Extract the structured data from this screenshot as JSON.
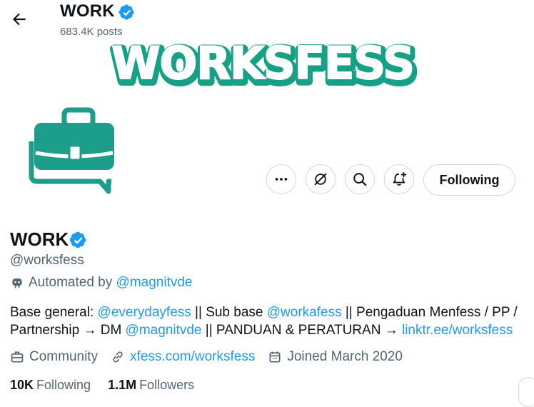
{
  "header": {
    "title": "WORK",
    "posts": "683.4K posts"
  },
  "banner": {
    "wordmark": "WORKSFESS",
    "fill_color": "#ffffff",
    "outline_color": "#16a085"
  },
  "avatar": {
    "icon": "briefcase-chat-icon",
    "color": "#1c9e8a"
  },
  "actions": {
    "following_label": "Following"
  },
  "profile": {
    "name": "WORK",
    "handle": "@worksfess",
    "automated_prefix": "Automated by ",
    "automated_link": "@magnitvde",
    "bio": {
      "t1": "Base general: ",
      "l1": "@everydayfess",
      "t2": " || Sub base ",
      "l2": "@workafess",
      "t3": " || Pengaduan Menfess / PP  / Partnership → DM ",
      "l3": "@magnitvde",
      "t4": " || PANDUAN & PERATURAN → ",
      "l4": "linktr.ee/worksfess"
    },
    "category": "Community",
    "website": "xfess.com/worksfess",
    "joined": "Joined March 2020",
    "following_count": "10K",
    "following_label": "Following",
    "followers_count": "1.1M",
    "followers_label": "Followers"
  },
  "colors": {
    "link": "#1d9bf0",
    "verified": "#1d9bf0",
    "secondary_text": "#536471"
  }
}
